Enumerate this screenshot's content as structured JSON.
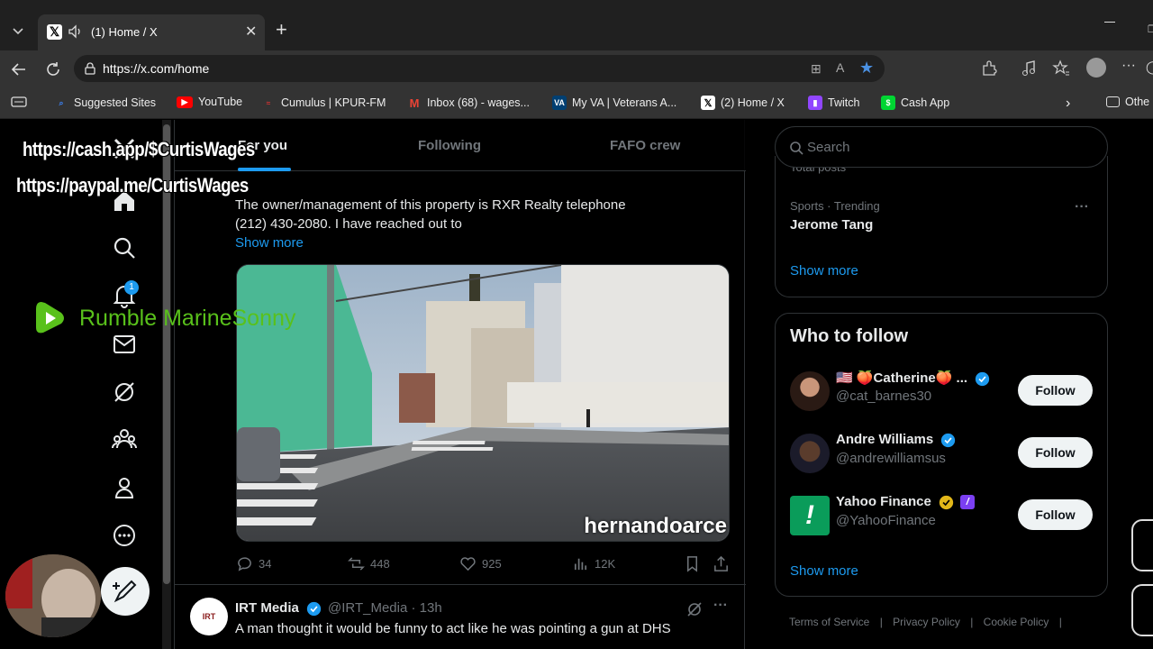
{
  "browser": {
    "tab_title": "(1) Home / X",
    "url": "https://x.com/home",
    "favorites": [
      {
        "label": "Suggested Sites",
        "icon": "search-icon",
        "color": "#3b82f6"
      },
      {
        "label": "YouTube",
        "icon": "youtube-icon",
        "color": "#ff0000"
      },
      {
        "label": "Cumulus | KPUR-FM",
        "icon": "cumulus-icon",
        "color": "#d33"
      },
      {
        "label": "Inbox (68) - wages...",
        "icon": "gmail-icon",
        "color": "#ea4335"
      },
      {
        "label": "My VA | Veterans A...",
        "icon": "va-icon",
        "color": "#003f72"
      },
      {
        "label": "(2) Home / X",
        "icon": "x-icon",
        "color": "#ffffff"
      },
      {
        "label": "Twitch",
        "icon": "twitch-icon",
        "color": "#9146ff"
      },
      {
        "label": "Cash App",
        "icon": "cashapp-icon",
        "color": "#00d632"
      }
    ],
    "other_favorites": "Othe"
  },
  "overlay": {
    "cash_link": "https://cash.app/$CurtisWages",
    "paypal_link": "https://paypal.me/CurtisWages",
    "rumble_label": "Rumble MarineSonny"
  },
  "nav": {
    "notification_count": "1"
  },
  "timeline": {
    "tabs": [
      "For you",
      "Following",
      "FAFO crew"
    ],
    "tweet1": {
      "line1": "The owner/management of this property is RXR Realty telephone",
      "line2": "(212) 430-2080.  I have reached out to",
      "show_more": "Show more",
      "media_watermark": "hernandoarce",
      "replies": "34",
      "reposts": "448",
      "likes": "925",
      "views": "12K"
    },
    "tweet2": {
      "avatar_text": "IRT",
      "name": "IRT Media",
      "handle": "@IRT_Media · 13h",
      "text": "A man thought it would be funny to act like he was pointing a gun at DHS"
    }
  },
  "sidebar": {
    "search_placeholder": "Search",
    "trend_partial": "Total posts",
    "trend_category": "Sports · Trending",
    "trend_name": "Jerome Tang",
    "trend_show_more": "Show more",
    "who_to_follow_title": "Who to follow",
    "who_to_follow": [
      {
        "name": "🇺🇸 🍑Catherine🍑 ...",
        "handle": "@cat_barnes30",
        "button": "Follow",
        "badge": "blue"
      },
      {
        "name": "Andre Williams",
        "handle": "@andrewilliamsus",
        "button": "Follow",
        "badge": "blue"
      },
      {
        "name": "Yahoo Finance",
        "handle": "@YahooFinance",
        "button": "Follow",
        "badge": "gold"
      }
    ],
    "wtf_show_more": "Show more",
    "footer": [
      "Terms of Service",
      "|",
      "Privacy Policy",
      "|",
      "Cookie Policy",
      "|"
    ]
  }
}
